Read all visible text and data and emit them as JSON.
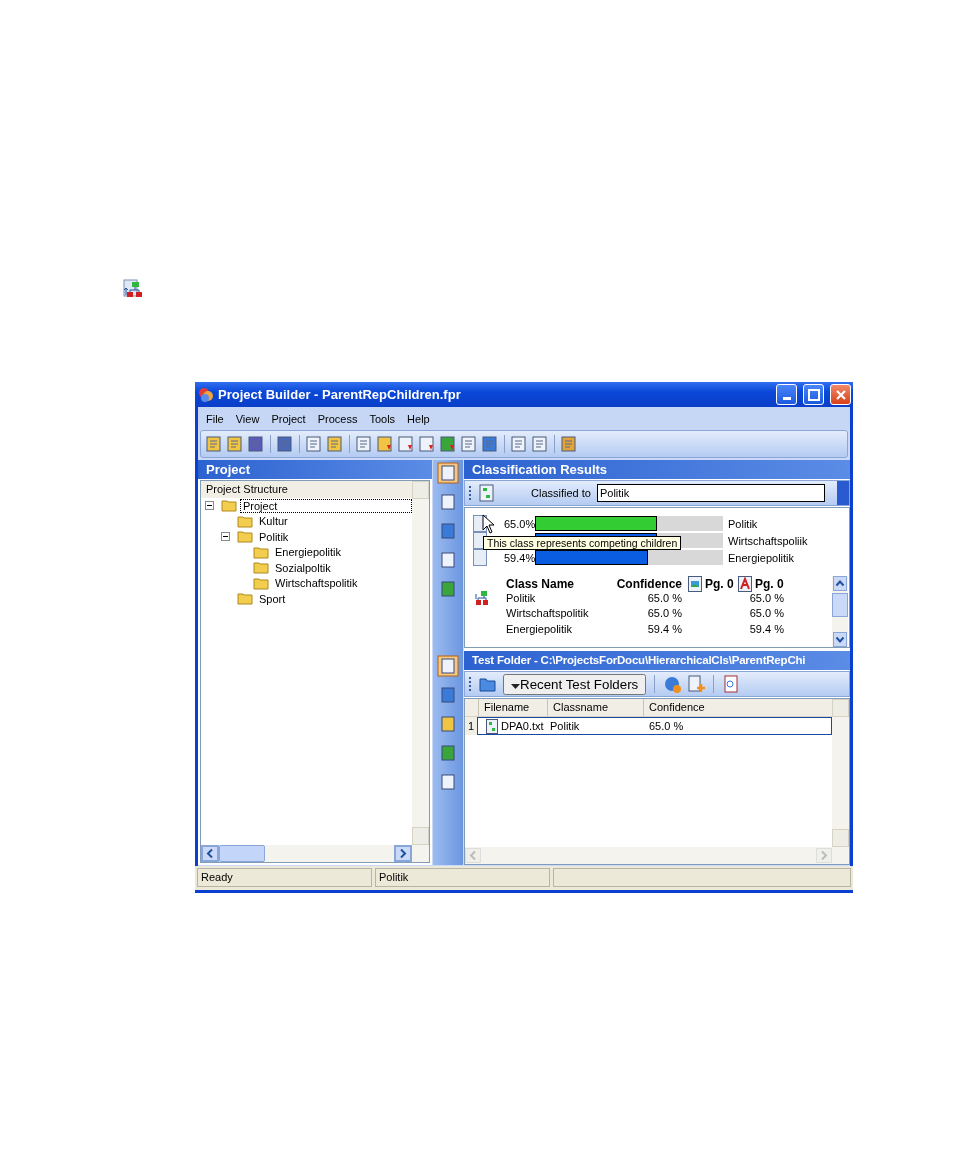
{
  "window": {
    "title": "Project Builder - ParentRepChildren.fpr"
  },
  "menu": [
    "File",
    "View",
    "Project",
    "Process",
    "Tools",
    "Help"
  ],
  "project_panel": {
    "title": "Project",
    "tree_header": "Project Structure",
    "tree": [
      {
        "label": "Project",
        "expanded": true,
        "selected": true,
        "children": [
          {
            "label": "Kultur",
            "selected": false
          },
          {
            "label": "Politik",
            "expanded": true,
            "selected": false,
            "children": [
              {
                "label": "Energiepolitik",
                "selected": false
              },
              {
                "label": "Sozialpoltik",
                "selected": false
              },
              {
                "label": "Wirtschaftspolitik",
                "selected": false
              }
            ]
          },
          {
            "label": "Sport",
            "selected": false
          }
        ]
      }
    ]
  },
  "view_buttons_top": [
    {
      "selected": true
    },
    {
      "selected": false
    },
    {
      "selected": false
    },
    {
      "selected": false
    },
    {
      "selected": false
    }
  ],
  "view_buttons_bottom": [
    {
      "selected": true
    },
    {
      "selected": false
    },
    {
      "selected": false
    },
    {
      "selected": false
    },
    {
      "selected": false
    }
  ],
  "classification": {
    "title": "Classification Results",
    "classified_to_label": "Classified to",
    "classified_to": "Politik",
    "bars": [
      {
        "percent": "65.0%",
        "level": 0.65,
        "color": "#33cc33",
        "name": "Politik"
      },
      {
        "level": 0.65,
        "color": "#0a5ce0",
        "name": "Wirtschaftspoliik"
      },
      {
        "percent": "59.4%",
        "level": 0.6,
        "color": "#0a5ce0",
        "name": "Energiepolitik"
      }
    ],
    "tooltip": "This class represents competing children",
    "columns": [
      "Class Name",
      "Confidence",
      "Pg. 0",
      "Pg. 0"
    ],
    "rows": [
      [
        "Politik",
        "65.0 %",
        "65.0 %"
      ],
      [
        "Wirtschaftspolitik",
        "65.0 %",
        "65.0 %"
      ],
      [
        "Energiepolitik",
        "59.4 %",
        "59.4 %"
      ]
    ]
  },
  "test_folder": {
    "title": "Test Folder - C:\\ProjectsForDocu\\HierarchicalCls\\ParentRepChi",
    "recent_label": "Recent Test Folders",
    "columns": [
      "Filename",
      "Classname",
      "Confidence"
    ],
    "rows": [
      {
        "index": "1",
        "filename": "DPA0.txt",
        "classname": "Politik",
        "confidence": "65.0 %",
        "selected": true
      }
    ]
  },
  "status_bar": [
    "Ready",
    "Politik"
  ]
}
